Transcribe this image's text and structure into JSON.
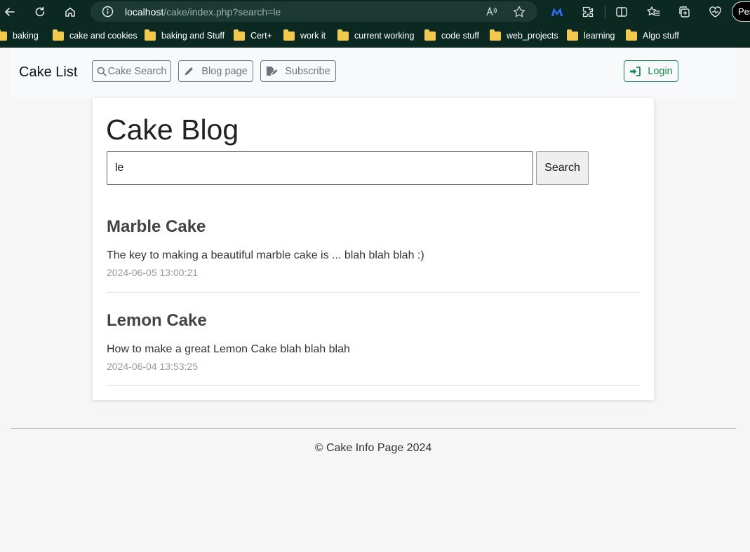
{
  "browser": {
    "url_host": "localhost",
    "url_path": "/cake/index.php?search=le",
    "profile_label": "Per",
    "bookmarks": [
      "baking",
      "cake and cookies",
      "baking and Stuff",
      "Cert+",
      "work it",
      "current working",
      "code stuff",
      "web_projects",
      "learning",
      "Algo stuff"
    ]
  },
  "navbar": {
    "brand": "Cake List",
    "cake_search": "Cake Search",
    "blog_page": "Blog page",
    "subscribe": "Subscribe",
    "login": "Login"
  },
  "page": {
    "title": "Cake Blog",
    "search_value": "le",
    "search_button": "Search"
  },
  "posts": [
    {
      "title": "Marble Cake",
      "body": "The key to making a beautiful marble cake is ... blah blah blah :)",
      "date": "2024-06-05 13:00:21"
    },
    {
      "title": "Lemon Cake",
      "body": "How to make a great Lemon Cake blah blah blah",
      "date": "2024-06-04 13:53:25"
    }
  ],
  "footer": {
    "text": "© Cake Info Page 2024"
  },
  "colors": {
    "browser_chrome": "#0b2921",
    "login_accent": "#198754",
    "secondary_outline": "#6c757d"
  }
}
